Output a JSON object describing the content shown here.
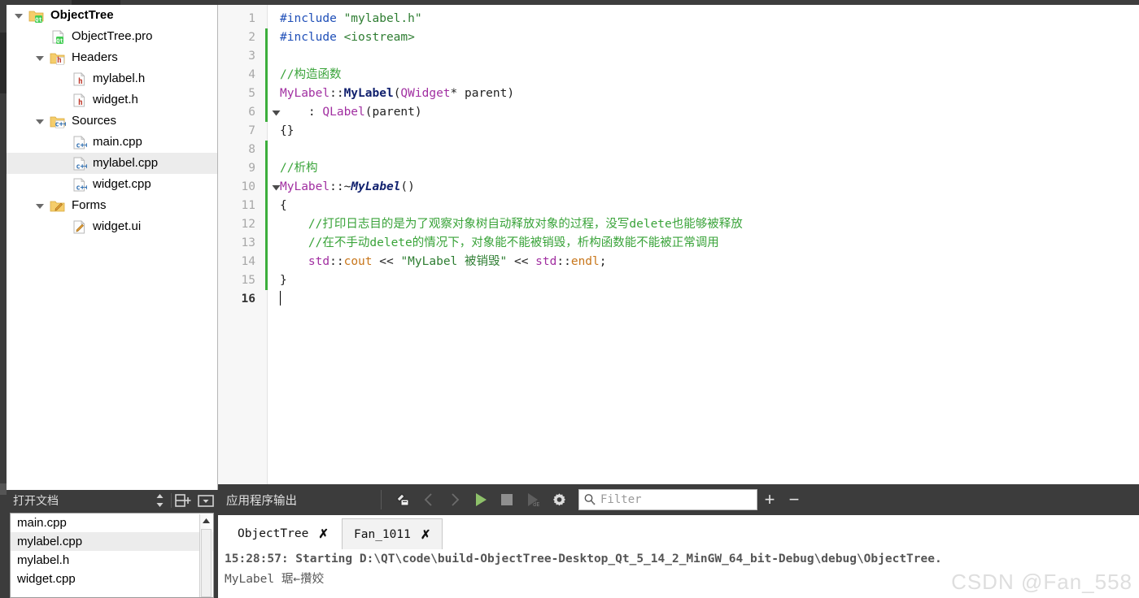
{
  "project_tree": {
    "rows": [
      {
        "label": "ObjectTree",
        "indent": 0,
        "icon": "qt-folder-icon",
        "twisty": "down",
        "bold": true,
        "selected": false
      },
      {
        "label": "ObjectTree.pro",
        "indent": 1,
        "icon": "qt-file-icon",
        "twisty": "none",
        "bold": false,
        "selected": false
      },
      {
        "label": "Headers",
        "indent": 1,
        "icon": "h-folder-icon",
        "twisty": "down",
        "bold": false,
        "selected": false
      },
      {
        "label": "mylabel.h",
        "indent": 2,
        "icon": "h-file-icon",
        "twisty": "none",
        "bold": false,
        "selected": false
      },
      {
        "label": "widget.h",
        "indent": 2,
        "icon": "h-file-icon",
        "twisty": "none",
        "bold": false,
        "selected": false
      },
      {
        "label": "Sources",
        "indent": 1,
        "icon": "cpp-folder-icon",
        "twisty": "down",
        "bold": false,
        "selected": false
      },
      {
        "label": "main.cpp",
        "indent": 2,
        "icon": "cpp-file-icon",
        "twisty": "none",
        "bold": false,
        "selected": false
      },
      {
        "label": "mylabel.cpp",
        "indent": 2,
        "icon": "cpp-file-icon",
        "twisty": "none",
        "bold": false,
        "selected": true
      },
      {
        "label": "widget.cpp",
        "indent": 2,
        "icon": "cpp-file-icon",
        "twisty": "none",
        "bold": false,
        "selected": false
      },
      {
        "label": "Forms",
        "indent": 1,
        "icon": "form-folder-icon",
        "twisty": "down",
        "bold": false,
        "selected": false
      },
      {
        "label": "widget.ui",
        "indent": 2,
        "icon": "form-file-icon",
        "twisty": "none",
        "bold": false,
        "selected": false
      }
    ]
  },
  "open_documents": {
    "title": "打开文档",
    "sync_icon": "sort-updown-icon",
    "split_icon": "split-add-icon",
    "menu_icon": "dropdown-box-icon",
    "items": [
      {
        "label": "main.cpp",
        "selected": false
      },
      {
        "label": "mylabel.cpp",
        "selected": true
      },
      {
        "label": "mylabel.h",
        "selected": false
      },
      {
        "label": "widget.cpp",
        "selected": false
      }
    ]
  },
  "editor": {
    "current_line": 16,
    "lines": [
      {
        "n": 1,
        "changed": false,
        "fold": "none",
        "tokens": [
          {
            "t": "#include ",
            "c": "t-pre"
          },
          {
            "t": "\"mylabel.h\"",
            "c": "t-str"
          }
        ]
      },
      {
        "n": 2,
        "changed": true,
        "fold": "none",
        "tokens": [
          {
            "t": "#include ",
            "c": "t-pre"
          },
          {
            "t": "<iostream>",
            "c": "t-ang"
          }
        ]
      },
      {
        "n": 3,
        "changed": true,
        "fold": "none",
        "tokens": []
      },
      {
        "n": 4,
        "changed": true,
        "fold": "none",
        "tokens": [
          {
            "t": "//构造函数",
            "c": "t-cmt"
          }
        ]
      },
      {
        "n": 5,
        "changed": true,
        "fold": "none",
        "tokens": [
          {
            "t": "MyLabel",
            "c": "t-type"
          },
          {
            "t": "::",
            "c": "t-plain"
          },
          {
            "t": "MyLabel",
            "c": "t-fn"
          },
          {
            "t": "(",
            "c": "t-plain"
          },
          {
            "t": "QWidget",
            "c": "t-type"
          },
          {
            "t": "* parent)",
            "c": "t-plain"
          }
        ]
      },
      {
        "n": 6,
        "changed": true,
        "fold": "down",
        "tokens": [
          {
            "t": "    : ",
            "c": "t-plain"
          },
          {
            "t": "QLabel",
            "c": "t-type"
          },
          {
            "t": "(parent)",
            "c": "t-plain"
          }
        ]
      },
      {
        "n": 7,
        "changed": false,
        "fold": "none",
        "tokens": [
          {
            "t": "{}",
            "c": "t-plain"
          }
        ]
      },
      {
        "n": 8,
        "changed": true,
        "fold": "none",
        "tokens": []
      },
      {
        "n": 9,
        "changed": true,
        "fold": "none",
        "tokens": [
          {
            "t": "//析构",
            "c": "t-cmt"
          }
        ]
      },
      {
        "n": 10,
        "changed": true,
        "fold": "down",
        "tokens": [
          {
            "t": "MyLabel",
            "c": "t-type"
          },
          {
            "t": "::~",
            "c": "t-plain"
          },
          {
            "t": "MyLabel",
            "c": "t-fni"
          },
          {
            "t": "()",
            "c": "t-plain"
          }
        ]
      },
      {
        "n": 11,
        "changed": true,
        "fold": "none",
        "tokens": [
          {
            "t": "{",
            "c": "t-plain"
          }
        ]
      },
      {
        "n": 12,
        "changed": true,
        "fold": "none",
        "tokens": [
          {
            "t": "    //打印日志目的是为了观察对象树自动释放对象的过程，没写delete也能够被释放",
            "c": "t-cmt"
          }
        ]
      },
      {
        "n": 13,
        "changed": true,
        "fold": "none",
        "tokens": [
          {
            "t": "    //在不手动delete的情况下，对象能不能被销毁，析构函数能不能被正常调用",
            "c": "t-cmt"
          }
        ]
      },
      {
        "n": 14,
        "changed": true,
        "fold": "none",
        "tokens": [
          {
            "t": "    ",
            "c": "t-plain"
          },
          {
            "t": "std",
            "c": "t-type"
          },
          {
            "t": "::",
            "c": "t-plain"
          },
          {
            "t": "cout",
            "c": "t-obj"
          },
          {
            "t": " << ",
            "c": "t-plain"
          },
          {
            "t": "\"MyLabel 被销毁\"",
            "c": "t-str"
          },
          {
            "t": " << ",
            "c": "t-plain"
          },
          {
            "t": "std",
            "c": "t-type"
          },
          {
            "t": "::",
            "c": "t-plain"
          },
          {
            "t": "endl",
            "c": "t-obj"
          },
          {
            "t": ";",
            "c": "t-plain"
          }
        ]
      },
      {
        "n": 15,
        "changed": true,
        "fold": "none",
        "tokens": [
          {
            "t": "}",
            "c": "t-plain"
          }
        ]
      },
      {
        "n": 16,
        "changed": false,
        "fold": "none",
        "tokens": []
      }
    ]
  },
  "output_pane": {
    "title": "应用程序输出",
    "toolbar": {
      "clear_icon": "clear-broom-icon",
      "prev_icon": "chevron-left-icon",
      "next_icon": "chevron-right-icon",
      "run_icon": "run-play-icon",
      "stop_icon": "stop-square-icon",
      "rerun_icon": "run-debug-icon",
      "settings_icon": "gear-icon",
      "add_label": "+",
      "remove_label": "−"
    },
    "filter": {
      "icon": "search-icon",
      "value": "",
      "placeholder": "Filter"
    },
    "tabs": [
      {
        "label": "ObjectTree",
        "active": false,
        "close_glyph": "✗"
      },
      {
        "label": "Fan_1011",
        "active": true,
        "close_glyph": "✗"
      }
    ],
    "lines": [
      "15:28:57: Starting D:\\QT\\code\\build-ObjectTree-Desktop_Qt_5_14_2_MinGW_64_bit-Debug\\debug\\ObjectTree.",
      "MyLabel 琚←攢姣"
    ]
  },
  "watermark": "CSDN @Fan_558",
  "colors": {
    "accent_green": "#3cae3c",
    "chrome_dark": "#3c3c3c",
    "editor_bg": "#ffffff",
    "selection": "#ececec",
    "run_green": "#8ec16a"
  }
}
